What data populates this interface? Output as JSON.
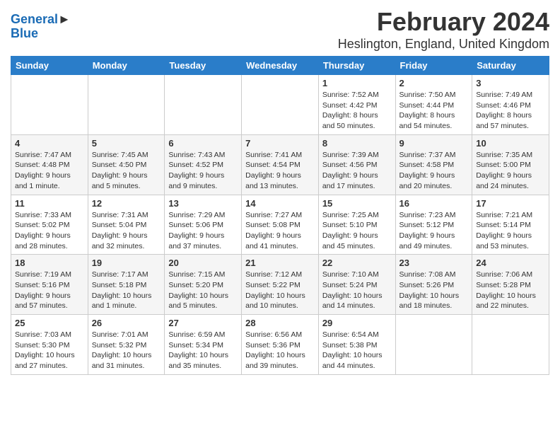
{
  "header": {
    "logo_line1": "General",
    "logo_line2": "Blue",
    "month": "February 2024",
    "location": "Heslington, England, United Kingdom"
  },
  "days_of_week": [
    "Sunday",
    "Monday",
    "Tuesday",
    "Wednesday",
    "Thursday",
    "Friday",
    "Saturday"
  ],
  "weeks": [
    {
      "days": [
        {
          "num": "",
          "info": ""
        },
        {
          "num": "",
          "info": ""
        },
        {
          "num": "",
          "info": ""
        },
        {
          "num": "",
          "info": ""
        },
        {
          "num": "1",
          "info": "Sunrise: 7:52 AM\nSunset: 4:42 PM\nDaylight: 8 hours\nand 50 minutes."
        },
        {
          "num": "2",
          "info": "Sunrise: 7:50 AM\nSunset: 4:44 PM\nDaylight: 8 hours\nand 54 minutes."
        },
        {
          "num": "3",
          "info": "Sunrise: 7:49 AM\nSunset: 4:46 PM\nDaylight: 8 hours\nand 57 minutes."
        }
      ]
    },
    {
      "days": [
        {
          "num": "4",
          "info": "Sunrise: 7:47 AM\nSunset: 4:48 PM\nDaylight: 9 hours\nand 1 minute."
        },
        {
          "num": "5",
          "info": "Sunrise: 7:45 AM\nSunset: 4:50 PM\nDaylight: 9 hours\nand 5 minutes."
        },
        {
          "num": "6",
          "info": "Sunrise: 7:43 AM\nSunset: 4:52 PM\nDaylight: 9 hours\nand 9 minutes."
        },
        {
          "num": "7",
          "info": "Sunrise: 7:41 AM\nSunset: 4:54 PM\nDaylight: 9 hours\nand 13 minutes."
        },
        {
          "num": "8",
          "info": "Sunrise: 7:39 AM\nSunset: 4:56 PM\nDaylight: 9 hours\nand 17 minutes."
        },
        {
          "num": "9",
          "info": "Sunrise: 7:37 AM\nSunset: 4:58 PM\nDaylight: 9 hours\nand 20 minutes."
        },
        {
          "num": "10",
          "info": "Sunrise: 7:35 AM\nSunset: 5:00 PM\nDaylight: 9 hours\nand 24 minutes."
        }
      ]
    },
    {
      "days": [
        {
          "num": "11",
          "info": "Sunrise: 7:33 AM\nSunset: 5:02 PM\nDaylight: 9 hours\nand 28 minutes."
        },
        {
          "num": "12",
          "info": "Sunrise: 7:31 AM\nSunset: 5:04 PM\nDaylight: 9 hours\nand 32 minutes."
        },
        {
          "num": "13",
          "info": "Sunrise: 7:29 AM\nSunset: 5:06 PM\nDaylight: 9 hours\nand 37 minutes."
        },
        {
          "num": "14",
          "info": "Sunrise: 7:27 AM\nSunset: 5:08 PM\nDaylight: 9 hours\nand 41 minutes."
        },
        {
          "num": "15",
          "info": "Sunrise: 7:25 AM\nSunset: 5:10 PM\nDaylight: 9 hours\nand 45 minutes."
        },
        {
          "num": "16",
          "info": "Sunrise: 7:23 AM\nSunset: 5:12 PM\nDaylight: 9 hours\nand 49 minutes."
        },
        {
          "num": "17",
          "info": "Sunrise: 7:21 AM\nSunset: 5:14 PM\nDaylight: 9 hours\nand 53 minutes."
        }
      ]
    },
    {
      "days": [
        {
          "num": "18",
          "info": "Sunrise: 7:19 AM\nSunset: 5:16 PM\nDaylight: 9 hours\nand 57 minutes."
        },
        {
          "num": "19",
          "info": "Sunrise: 7:17 AM\nSunset: 5:18 PM\nDaylight: 10 hours\nand 1 minute."
        },
        {
          "num": "20",
          "info": "Sunrise: 7:15 AM\nSunset: 5:20 PM\nDaylight: 10 hours\nand 5 minutes."
        },
        {
          "num": "21",
          "info": "Sunrise: 7:12 AM\nSunset: 5:22 PM\nDaylight: 10 hours\nand 10 minutes."
        },
        {
          "num": "22",
          "info": "Sunrise: 7:10 AM\nSunset: 5:24 PM\nDaylight: 10 hours\nand 14 minutes."
        },
        {
          "num": "23",
          "info": "Sunrise: 7:08 AM\nSunset: 5:26 PM\nDaylight: 10 hours\nand 18 minutes."
        },
        {
          "num": "24",
          "info": "Sunrise: 7:06 AM\nSunset: 5:28 PM\nDaylight: 10 hours\nand 22 minutes."
        }
      ]
    },
    {
      "days": [
        {
          "num": "25",
          "info": "Sunrise: 7:03 AM\nSunset: 5:30 PM\nDaylight: 10 hours\nand 27 minutes."
        },
        {
          "num": "26",
          "info": "Sunrise: 7:01 AM\nSunset: 5:32 PM\nDaylight: 10 hours\nand 31 minutes."
        },
        {
          "num": "27",
          "info": "Sunrise: 6:59 AM\nSunset: 5:34 PM\nDaylight: 10 hours\nand 35 minutes."
        },
        {
          "num": "28",
          "info": "Sunrise: 6:56 AM\nSunset: 5:36 PM\nDaylight: 10 hours\nand 39 minutes."
        },
        {
          "num": "29",
          "info": "Sunrise: 6:54 AM\nSunset: 5:38 PM\nDaylight: 10 hours\nand 44 minutes."
        },
        {
          "num": "",
          "info": ""
        },
        {
          "num": "",
          "info": ""
        }
      ]
    }
  ]
}
